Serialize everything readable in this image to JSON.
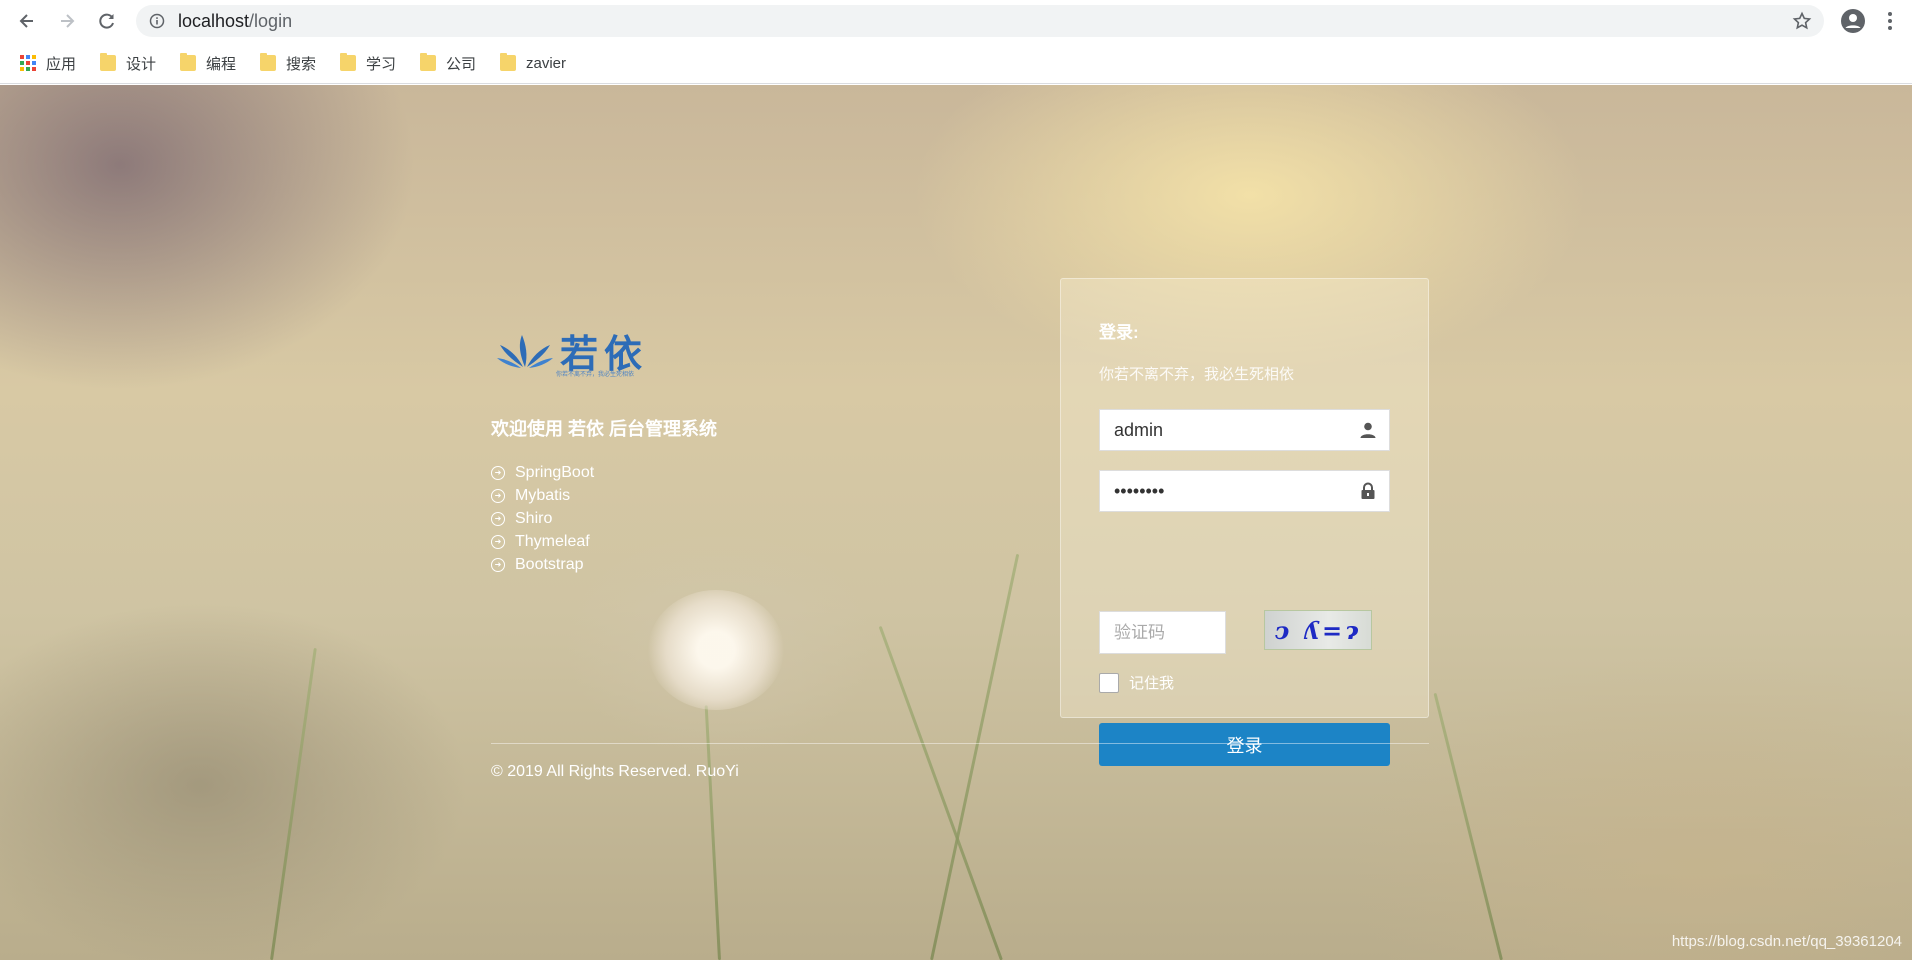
{
  "browser": {
    "url_host": "localhost",
    "url_path": "/login",
    "bookmarks": [
      "应用",
      "设计",
      "编程",
      "搜索",
      "学习",
      "公司",
      "zavier"
    ]
  },
  "brand": {
    "title": "若依",
    "subtitle": "你若不离不弃，我必生死相依",
    "color": "#2d6cb7"
  },
  "intro": {
    "welcome": "欢迎使用 若依 后台管理系统",
    "techs": [
      "SpringBoot",
      "Mybatis",
      "Shiro",
      "Thymeleaf",
      "Bootstrap"
    ]
  },
  "login": {
    "title": "登录:",
    "subtitle": "你若不离不弃，我必生死相依",
    "username_value": "admin",
    "password_value": "admin123",
    "captcha_placeholder": "验证码",
    "captcha_text": "ↄ ʎ=ɂ",
    "remember_label": "记住我",
    "remember_checked": false,
    "submit_label": "登录",
    "button_color": "#1c84c6"
  },
  "footer": {
    "copyright": "© 2019 All Rights Reserved. RuoYi"
  },
  "watermark": "https://blog.csdn.net/qq_39361204"
}
